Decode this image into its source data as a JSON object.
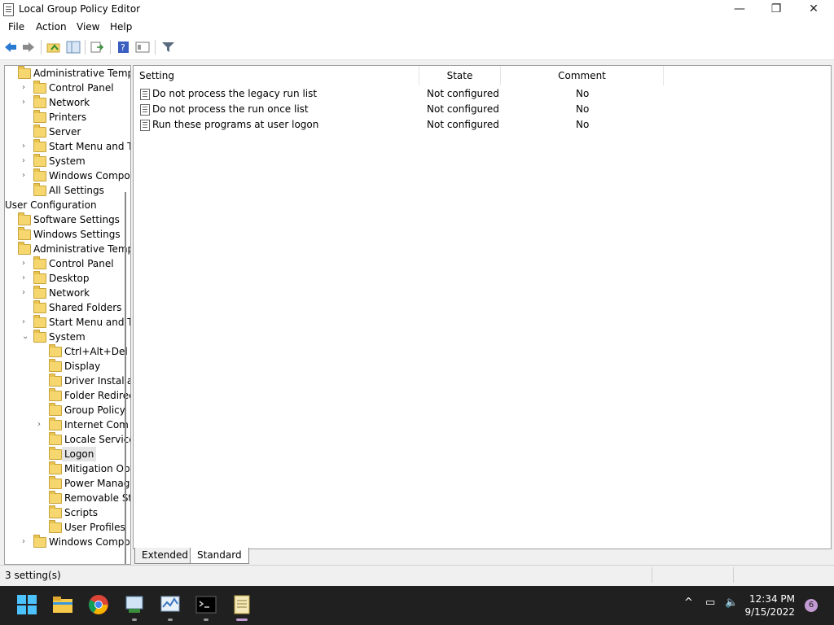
{
  "window": {
    "title": "Local Group Policy Editor",
    "controls": {
      "minimize": "—",
      "maximize": "❐",
      "close": "✕"
    }
  },
  "menu": [
    "File",
    "Action",
    "View",
    "Help"
  ],
  "toolbar": {
    "buttons": [
      "back-icon",
      "forward-icon",
      "up-folder-icon",
      "show-hide-tree-icon",
      "export-list-icon",
      "help-icon",
      "properties-icon",
      "filter-icon"
    ]
  },
  "tree": {
    "items": [
      {
        "label": "Administrative Templa",
        "level": 1,
        "expander": ""
      },
      {
        "label": "Control Panel",
        "level": 2,
        "expander": "›"
      },
      {
        "label": "Network",
        "level": 2,
        "expander": "›"
      },
      {
        "label": "Printers",
        "level": 2,
        "expander": ""
      },
      {
        "label": "Server",
        "level": 2,
        "expander": ""
      },
      {
        "label": "Start Menu and Tas",
        "level": 2,
        "expander": "›"
      },
      {
        "label": "System",
        "level": 2,
        "expander": "›"
      },
      {
        "label": "Windows Compon",
        "level": 2,
        "expander": "›"
      },
      {
        "label": "All Settings",
        "level": 2,
        "expander": ""
      },
      {
        "label": "User Configuration",
        "level": 0,
        "expander": ""
      },
      {
        "label": "Software Settings",
        "level": 1,
        "expander": ""
      },
      {
        "label": "Windows Settings",
        "level": 1,
        "expander": ""
      },
      {
        "label": "Administrative Templa",
        "level": 1,
        "expander": ""
      },
      {
        "label": "Control Panel",
        "level": 2,
        "expander": "›"
      },
      {
        "label": "Desktop",
        "level": 2,
        "expander": "›"
      },
      {
        "label": "Network",
        "level": 2,
        "expander": "›"
      },
      {
        "label": "Shared Folders",
        "level": 2,
        "expander": ""
      },
      {
        "label": "Start Menu and Tas",
        "level": 2,
        "expander": "›"
      },
      {
        "label": "System",
        "level": 2,
        "expander": "⌄"
      },
      {
        "label": "Ctrl+Alt+Del O",
        "level": 3,
        "expander": ""
      },
      {
        "label": "Display",
        "level": 3,
        "expander": ""
      },
      {
        "label": "Driver Installati",
        "level": 3,
        "expander": ""
      },
      {
        "label": "Folder Redirect",
        "level": 3,
        "expander": ""
      },
      {
        "label": "Group Policy",
        "level": 3,
        "expander": ""
      },
      {
        "label": "Internet Com",
        "level": 3,
        "expander": "›"
      },
      {
        "label": "Locale Services",
        "level": 3,
        "expander": ""
      },
      {
        "label": "Logon",
        "level": 3,
        "expander": "",
        "selected": true
      },
      {
        "label": "Mitigation Opti",
        "level": 3,
        "expander": ""
      },
      {
        "label": "Power Manage",
        "level": 3,
        "expander": ""
      },
      {
        "label": "Removable Sto",
        "level": 3,
        "expander": ""
      },
      {
        "label": "Scripts",
        "level": 3,
        "expander": ""
      },
      {
        "label": "User Profiles",
        "level": 3,
        "expander": ""
      },
      {
        "label": "Windows Compon",
        "level": 2,
        "expander": "›"
      }
    ]
  },
  "list": {
    "columns": [
      "Setting",
      "State",
      "Comment"
    ],
    "rows": [
      {
        "setting": "Do not process the legacy run list",
        "state": "Not configured",
        "comment": "No"
      },
      {
        "setting": "Do not process the run once list",
        "state": "Not configured",
        "comment": "No"
      },
      {
        "setting": "Run these programs at user logon",
        "state": "Not configured",
        "comment": "No"
      }
    ]
  },
  "tabs": [
    "Extended",
    "Standard"
  ],
  "status": {
    "text": "3 setting(s)"
  },
  "taskbar": {
    "apps": [
      "start-icon",
      "file-explorer-icon",
      "chrome-icon",
      "group-policy-icon",
      "task-manager-icon",
      "terminal-icon",
      "notepad-icon"
    ],
    "time": "12:34 PM",
    "date": "9/15/2022",
    "notifications": "6",
    "tray": {
      "chevron": "^",
      "network": "▭",
      "volume": "🔈"
    }
  }
}
